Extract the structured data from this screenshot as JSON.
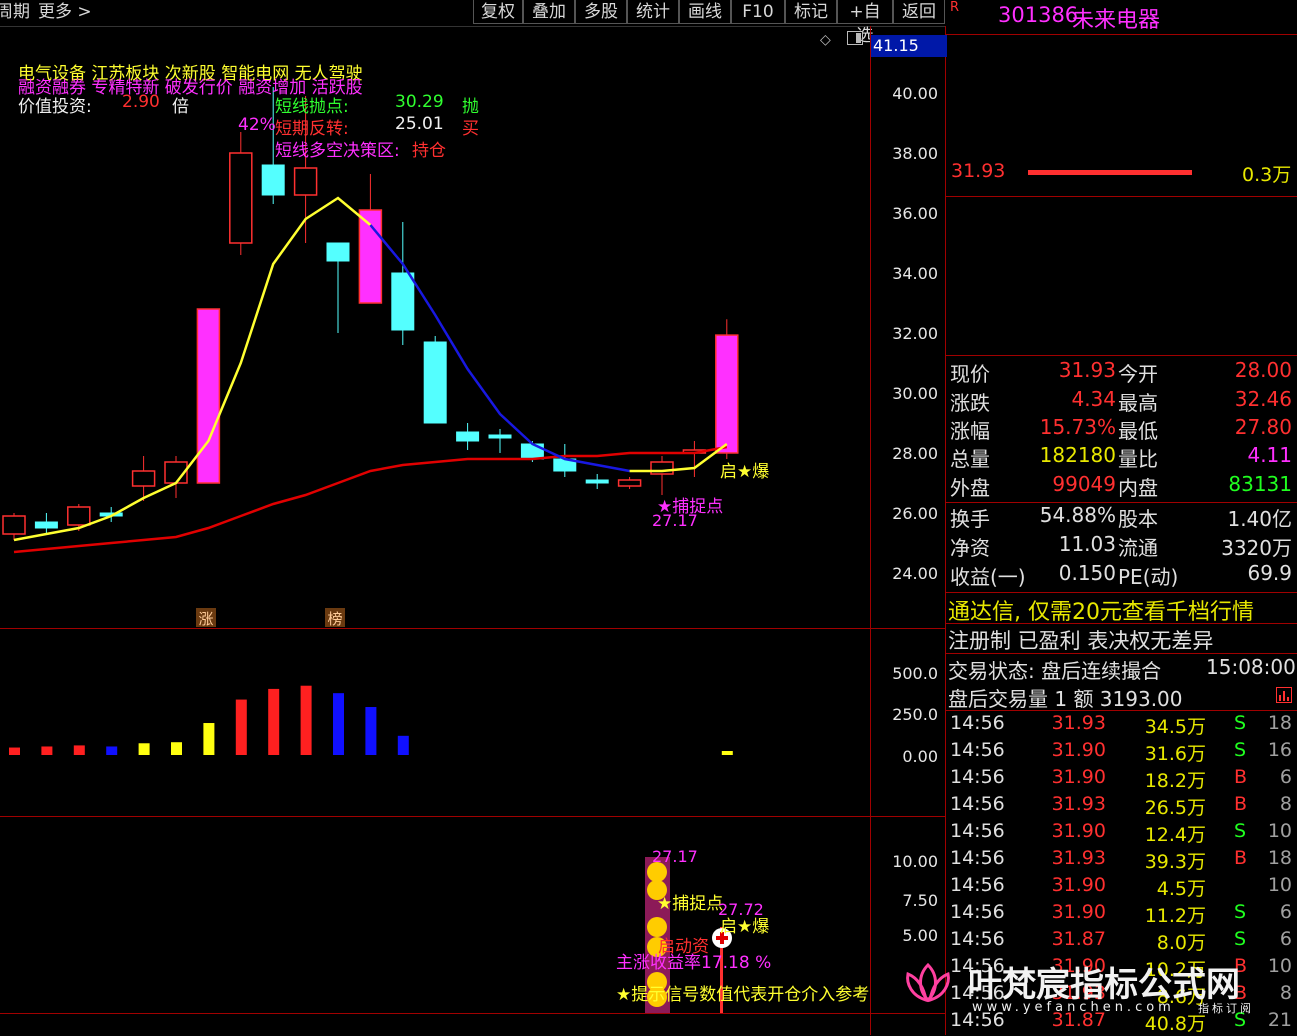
{
  "toolbar": {
    "left_items": [
      "周期",
      "更多 >"
    ],
    "buttons": [
      "复权",
      "叠加",
      "多股",
      "统计",
      "画线",
      "F10",
      "标记",
      "+自选",
      "返回"
    ]
  },
  "chart": {
    "top_price_tag": "41.15",
    "price_axis": [
      "40.00",
      "38.00",
      "36.00",
      "34.00",
      "32.00",
      "30.00",
      "28.00",
      "26.00",
      "24.00"
    ],
    "volume_axis": [
      "500.0",
      "250.0",
      "0.00"
    ],
    "indicator_axis": [
      "10.00",
      "7.50",
      "5.00"
    ],
    "sectors_line": "电气设备  江苏板块  次新股  智能电网  无人驾驶",
    "tags_line": "融资融券  专精特新  破发行价  融资增加  活跃股",
    "value_label": "价值投资:",
    "value_num": "2.90",
    "value_unit": "倍",
    "peak_pct": "42%",
    "sell_point_label": "短线抛点:",
    "sell_point_value": "30.29",
    "sell_point_tag": "抛",
    "reversal_label": "短期反转:",
    "reversal_value": "25.01",
    "reversal_tag": "买",
    "decision_label": "短线多空决策区:",
    "decision_value": "持仓",
    "qi_bao": "启★爆",
    "capture_point": "★捕捉点",
    "low_label": "27.17",
    "marker_zhang": "涨",
    "marker_bang": "榜",
    "ind_low": "27.17",
    "ind_capture": "★捕捉点",
    "ind_close": "27.72",
    "ind_qi_bao": "启★爆",
    "ind_launch": "启动资",
    "ind_profit": "主涨收益率17.18 %",
    "ind_hint": "★提示信号数值代表开仓介入参考"
  },
  "chart_data": {
    "type": "candlestick",
    "ylim": [
      23,
      42
    ],
    "candles": [
      {
        "open": 25.3,
        "close": 25.9,
        "high": 26.0,
        "low": 25.1,
        "up": true
      },
      {
        "open": 25.7,
        "close": 25.5,
        "high": 26.0,
        "low": 25.3,
        "up": false
      },
      {
        "open": 25.6,
        "close": 26.2,
        "high": 26.3,
        "low": 25.4,
        "up": true
      },
      {
        "open": 26.0,
        "close": 25.9,
        "high": 26.2,
        "low": 25.7,
        "up": false
      },
      {
        "open": 26.9,
        "close": 27.4,
        "high": 27.9,
        "low": 26.4,
        "up": true
      },
      {
        "open": 27.0,
        "close": 27.7,
        "high": 27.9,
        "low": 26.5,
        "up": true
      },
      {
        "open": 27.0,
        "close": 32.8,
        "high": 32.8,
        "low": 27.0,
        "up": true
      },
      {
        "open": 35.0,
        "close": 38.0,
        "high": 38.7,
        "low": 34.6,
        "up": true
      },
      {
        "open": 37.6,
        "close": 36.6,
        "high": 40.2,
        "low": 36.3,
        "up": false
      },
      {
        "open": 36.6,
        "close": 37.5,
        "high": 39.9,
        "low": 35.0,
        "up": true
      },
      {
        "open": 35.0,
        "close": 34.4,
        "high": 35.0,
        "low": 32.0,
        "up": false
      },
      {
        "open": 33.0,
        "close": 36.1,
        "high": 37.3,
        "low": 33.0,
        "up": true
      },
      {
        "open": 34.0,
        "close": 32.1,
        "high": 35.7,
        "low": 31.6,
        "up": false
      },
      {
        "open": 31.7,
        "close": 29.0,
        "high": 31.9,
        "low": 29.0,
        "up": false
      },
      {
        "open": 28.7,
        "close": 28.4,
        "high": 29.0,
        "low": 28.1,
        "up": false
      },
      {
        "open": 28.6,
        "close": 28.5,
        "high": 28.8,
        "low": 28.0,
        "up": false
      },
      {
        "open": 28.3,
        "close": 27.8,
        "high": 28.4,
        "low": 27.7,
        "up": false
      },
      {
        "open": 27.8,
        "close": 27.4,
        "high": 28.3,
        "low": 27.2,
        "up": false
      },
      {
        "open": 27.1,
        "close": 27.0,
        "high": 27.3,
        "low": 26.8,
        "up": false
      },
      {
        "open": 26.9,
        "close": 27.1,
        "high": 27.2,
        "low": 26.8,
        "up": true
      },
      {
        "open": 27.3,
        "close": 27.7,
        "high": 27.9,
        "low": 26.6,
        "up": true
      },
      {
        "open": 28.0,
        "close": 28.1,
        "high": 28.4,
        "low": 27.2,
        "up": true
      },
      {
        "open": 28.0,
        "close": 31.93,
        "high": 32.46,
        "low": 27.8,
        "up": true
      }
    ],
    "ma_short": [
      25.1,
      25.3,
      25.5,
      25.9,
      26.5,
      27.0,
      28.4,
      31.0,
      34.3,
      35.8,
      36.5,
      35.6,
      34.3,
      32.6,
      30.8,
      29.3,
      28.3,
      27.8,
      27.6,
      27.4,
      27.4,
      27.5,
      28.3
    ],
    "ma_long": [
      24.7,
      24.8,
      24.9,
      25.0,
      25.1,
      25.2,
      25.5,
      25.9,
      26.3,
      26.6,
      27.0,
      27.4,
      27.6,
      27.7,
      27.8,
      27.8,
      27.8,
      27.9,
      27.9,
      28.0,
      28.0,
      28.0,
      28.2
    ],
    "volume": [
      {
        "i": 0,
        "v": 35,
        "color": "#ff2020"
      },
      {
        "i": 1,
        "v": 40,
        "color": "#ff2020"
      },
      {
        "i": 2,
        "v": 45,
        "color": "#ff2020"
      },
      {
        "i": 3,
        "v": 40,
        "color": "#1010ff"
      },
      {
        "i": 4,
        "v": 55,
        "color": "#ffff10"
      },
      {
        "i": 5,
        "v": 60,
        "color": "#ffff10"
      },
      {
        "i": 6,
        "v": 150,
        "color": "#ffff10"
      },
      {
        "i": 7,
        "v": 260,
        "color": "#ff2020"
      },
      {
        "i": 8,
        "v": 310,
        "color": "#ff2020"
      },
      {
        "i": 9,
        "v": 325,
        "color": "#ff2020"
      },
      {
        "i": 10,
        "v": 290,
        "color": "#1010ff"
      },
      {
        "i": 11,
        "v": 225,
        "color": "#1010ff"
      },
      {
        "i": 12,
        "v": 90,
        "color": "#1010ff"
      },
      {
        "i": 22,
        "v": 15,
        "color": "#ffff10"
      }
    ],
    "volume_ylim": [
      0,
      500
    ]
  },
  "quote": {
    "code": "301386",
    "name": "未来电器",
    "badge": "R",
    "bid_price": "31.93",
    "bid_vol": "0.3万",
    "rows": [
      {
        "l1": "现价",
        "v1": "31.93",
        "c1": "#ff3030",
        "l2": "今开",
        "v2": "28.00",
        "c2": "#ff3030"
      },
      {
        "l1": "涨跌",
        "v1": "4.34",
        "c1": "#ff3030",
        "l2": "最高",
        "v2": "32.46",
        "c2": "#ff3030"
      },
      {
        "l1": "涨幅",
        "v1": "15.73%",
        "c1": "#ff3030",
        "l2": "最低",
        "v2": "27.80",
        "c2": "#ff3030"
      },
      {
        "l1": "总量",
        "v1": "182180",
        "c1": "#e8e800",
        "l2": "量比",
        "v2": "4.11",
        "c2": "#ff30ff"
      },
      {
        "l1": "外盘",
        "v1": "99049",
        "c1": "#ff3030",
        "l2": "内盘",
        "v2": "83131",
        "c2": "#20ff20"
      },
      {
        "l1": "换手",
        "v1": "54.88%",
        "c1": "#e0e0e0",
        "l2": "股本",
        "v2": "1.40亿",
        "c2": "#e0e0e0"
      },
      {
        "l1": "净资",
        "v1": "11.03",
        "c1": "#e0e0e0",
        "l2": "流通",
        "v2": "3320万",
        "c2": "#e0e0e0"
      },
      {
        "l1": "收益(一)",
        "v1": "0.150",
        "c1": "#e0e0e0",
        "l2": "PE(动)",
        "v2": "69.9",
        "c2": "#e0e0e0"
      }
    ],
    "promo": "通达信, 仅需20元查看千档行情",
    "reg_info": "注册制 已盈利 表决权无差异",
    "trade_status_label": "交易状态: 盘后连续撮合",
    "trade_status_time": "15:08:00",
    "after_hours": "盘后交易量 1 额 3193.00",
    "ticks": [
      {
        "t": "14:56",
        "p": "31.93",
        "v": "34.5万",
        "s": "S",
        "n": "18"
      },
      {
        "t": "14:56",
        "p": "31.90",
        "v": "31.6万",
        "s": "S",
        "n": "16"
      },
      {
        "t": "14:56",
        "p": "31.90",
        "v": "18.2万",
        "s": "B",
        "n": "6"
      },
      {
        "t": "14:56",
        "p": "31.93",
        "v": "26.5万",
        "s": "B",
        "n": "8"
      },
      {
        "t": "14:56",
        "p": "31.90",
        "v": "12.4万",
        "s": "S",
        "n": "10"
      },
      {
        "t": "14:56",
        "p": "31.93",
        "v": "39.3万",
        "s": "B",
        "n": "18"
      },
      {
        "t": "14:56",
        "p": "31.90",
        "v": "4.5万",
        "s": "",
        "n": "10"
      },
      {
        "t": "14:56",
        "p": "31.90",
        "v": "11.2万",
        "s": "S",
        "n": "6"
      },
      {
        "t": "14:56",
        "p": "31.87",
        "v": "8.0万",
        "s": "S",
        "n": "6"
      },
      {
        "t": "14:56",
        "p": "31.90",
        "v": "10.2万",
        "s": "B",
        "n": "10"
      },
      {
        "t": "14:56",
        "p": "31.93",
        "v": "8.6万",
        "s": "B",
        "n": "8"
      },
      {
        "t": "14:56",
        "p": "31.87",
        "v": "40.8万",
        "s": "S",
        "n": "21"
      }
    ]
  },
  "watermark": {
    "title": "叶梵宸指标公式网",
    "url": "www.yefanchen.com",
    "sub": "指标订阅"
  }
}
